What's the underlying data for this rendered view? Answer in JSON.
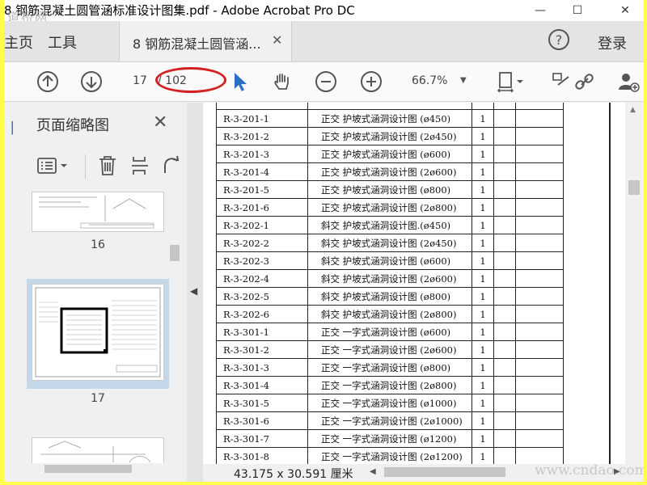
{
  "window": {
    "title": "8 钢筋混凝土圆管涵标准设计图集.pdf - Adobe Acrobat Pro DC",
    "watermark_top": "道桥网",
    "minimize": "—",
    "maximize": "☐",
    "close": "✕"
  },
  "tabbar": {
    "home": "主页",
    "tools": "工具",
    "doc_tab": "8 钢筋混凝土圆管涵...",
    "doc_tab_close": "✕",
    "help": "?",
    "login": "登录"
  },
  "toolbar": {
    "page_current": "17",
    "page_total": "/ 102",
    "zoom": "66.7%",
    "zoom_caret": "▼"
  },
  "left_pane": {
    "title": "页面缩略图",
    "close": "✕",
    "thumbnails": [
      {
        "label": "16"
      },
      {
        "label": "17"
      }
    ]
  },
  "document": {
    "rows": [
      {
        "code": "R-3-201-1",
        "name": "正交  护坡式涵洞设计图 (ø450)",
        "qty": "1"
      },
      {
        "code": "R-3-201-2",
        "name": "正交  护坡式涵洞设计图 (2ø450)",
        "qty": "1"
      },
      {
        "code": "R-3-201-3",
        "name": "正交  护坡式涵洞设计图 (ø600)",
        "qty": "1"
      },
      {
        "code": "R-3-201-4",
        "name": "正交  护坡式涵洞设计图 (2ø600)",
        "qty": "1"
      },
      {
        "code": "R-3-201-5",
        "name": "正交  护坡式涵洞设计图 (ø800)",
        "qty": "1"
      },
      {
        "code": "R-3-201-6",
        "name": "正交  护坡式涵洞设计图 (2ø800)",
        "qty": "1"
      },
      {
        "code": "R-3-202-1",
        "name": "斜交  护坡式涵洞设计图.(ø450)",
        "qty": "1"
      },
      {
        "code": "R-3-202-2",
        "name": "斜交  护坡式涵洞设计图 (2ø450)",
        "qty": "1"
      },
      {
        "code": "R-3-202-3",
        "name": "斜交  护坡式涵洞设计图 (ø600)",
        "qty": "1"
      },
      {
        "code": "R-3-202-4",
        "name": "斜交  护坡式涵洞设计图 (2ø600)",
        "qty": "1"
      },
      {
        "code": "R-3-202-5",
        "name": "斜交  护坡式涵洞设计图 (ø800)",
        "qty": "1"
      },
      {
        "code": "R-3-202-6",
        "name": "斜交  护坡式涵洞设计图 (2ø800)",
        "qty": "1"
      },
      {
        "code": "R-3-301-1",
        "name": "正交  一字式涵洞设计图 (ø600)",
        "qty": "1"
      },
      {
        "code": "R-3-301-2",
        "name": "正交  一字式涵洞设计图 (2ø600)",
        "qty": "1"
      },
      {
        "code": "R-3-301-3",
        "name": "正交  一字式涵洞设计图 (ø800)",
        "qty": "1"
      },
      {
        "code": "R-3-301-4",
        "name": "正交  一字式涵洞设计图 (2ø800)",
        "qty": "1"
      },
      {
        "code": "R-3-301-5",
        "name": "正交  一字式涵洞设计图 (ø1000)",
        "qty": "1"
      },
      {
        "code": "R-3-301-6",
        "name": "正交  一字式涵洞设计图 (2ø1000)",
        "qty": "1"
      },
      {
        "code": "R-3-301-7",
        "name": "正交  一字式涵洞设计图 (ø1200)",
        "qty": "1"
      },
      {
        "code": "R-3-301-8",
        "name": "正交  一字式涵洞设计图 (2ø1200)",
        "qty": "1"
      }
    ]
  },
  "statusbar": {
    "page_size": "43.175 x 30.591 厘米",
    "watermark": "www.cndao.com"
  }
}
